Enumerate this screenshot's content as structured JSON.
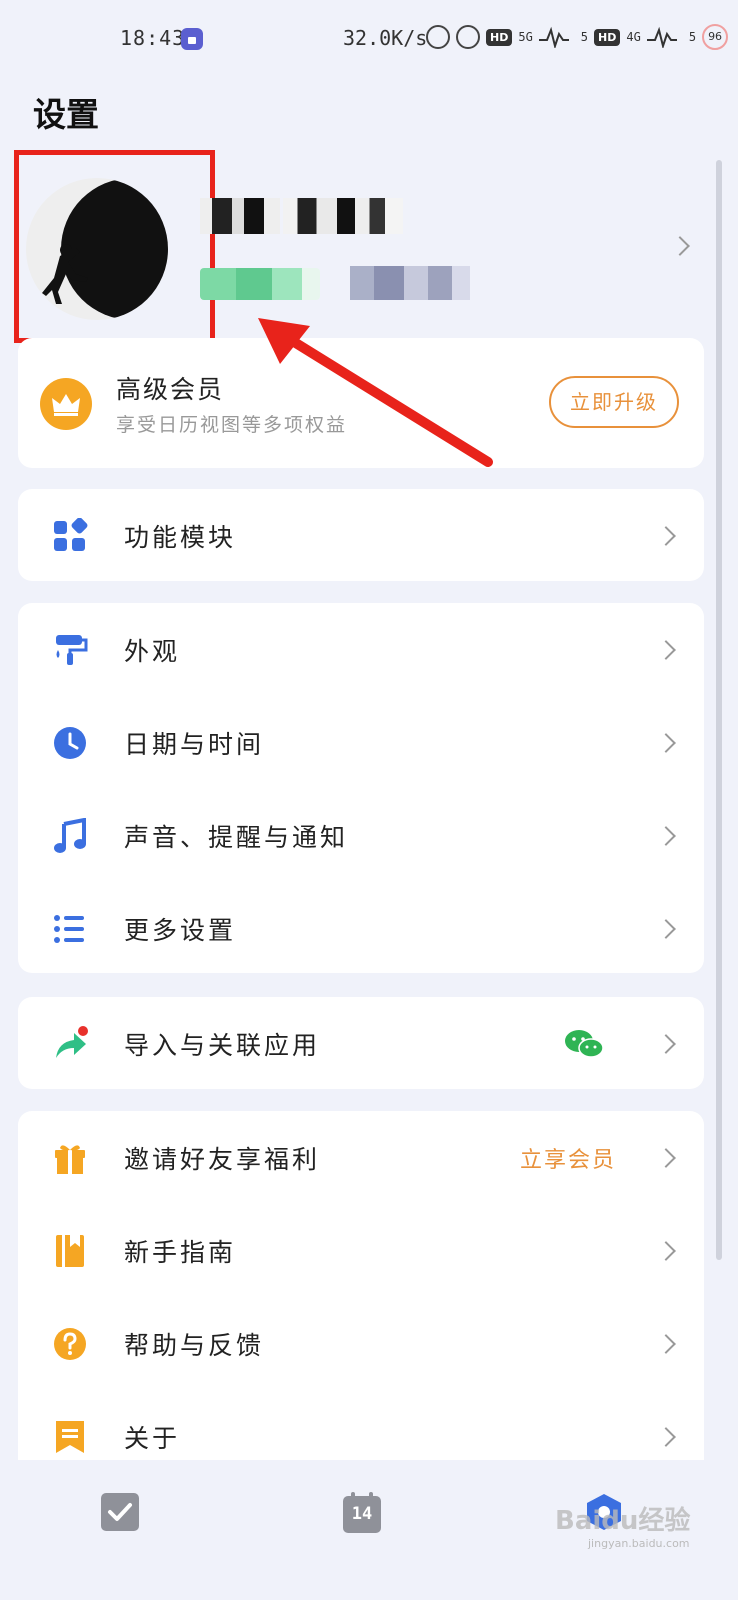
{
  "status_bar": {
    "time": "18:43",
    "speed": "32.0K/s",
    "battery": "96",
    "hd1": "HD",
    "hd2": "HD",
    "net1": "5G",
    "net2": "4G",
    "sig1": "5",
    "sig2": "5"
  },
  "header": {
    "title": "设置"
  },
  "vip": {
    "title": "高级会员",
    "subtitle": "享受日历视图等多项权益",
    "button": "立即升级"
  },
  "groups": [
    {
      "items": [
        {
          "label": "功能模块",
          "icon": "grid-icon"
        }
      ]
    },
    {
      "items": [
        {
          "label": "外观",
          "icon": "paint-roller-icon"
        },
        {
          "label": "日期与时间",
          "icon": "clock-icon"
        },
        {
          "label": "声音、提醒与通知",
          "icon": "music-note-icon"
        },
        {
          "label": "更多设置",
          "icon": "list-settings-icon"
        }
      ]
    },
    {
      "items": [
        {
          "label": "导入与关联应用",
          "icon": "share-arrow-icon"
        }
      ]
    },
    {
      "items": [
        {
          "label": "邀请好友享福利",
          "icon": "gift-icon",
          "extra": "立享会员"
        },
        {
          "label": "新手指南",
          "icon": "book-icon"
        },
        {
          "label": "帮助与反馈",
          "icon": "question-icon"
        },
        {
          "label": "关于",
          "icon": "bookmark-icon"
        }
      ]
    }
  ],
  "tabbar": {
    "calendar_day": "14"
  },
  "watermark": {
    "text": "Baidu经验",
    "sub": "jingyan.baidu.com"
  },
  "colors": {
    "accent_blue": "#3b6fe0",
    "accent_orange": "#e8913b",
    "annotation_red": "#e8231b",
    "background": "#f0f2fa"
  }
}
